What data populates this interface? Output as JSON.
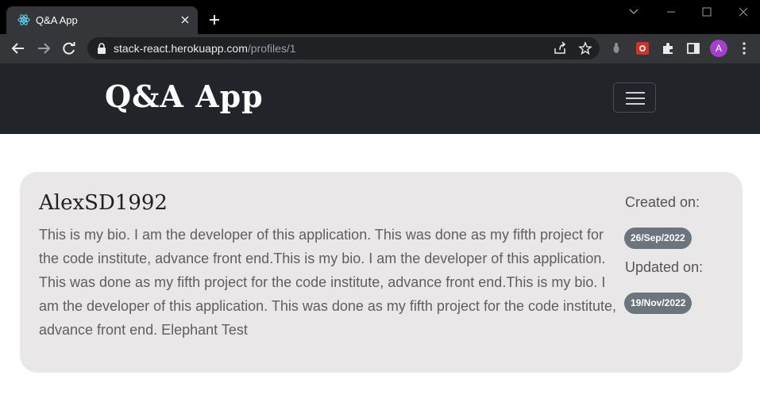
{
  "browser": {
    "tab_title": "Q&A App",
    "url_host": "stack-react.herokuapp.com",
    "url_path": "/profiles/1",
    "profile_initial": "A"
  },
  "navbar": {
    "brand": "Q&A App"
  },
  "profile": {
    "username": "AlexSD1992",
    "bio": "This is my bio. I am the developer of this application. This was done as my fifth project for the code institute, advance front end.This is my bio. I am the developer of this application. This was done as my fifth project for the code institute, advance front end.This is my bio. I am the developer of this application. This was done as my fifth project for the code institute, advance front end. Elephant Test",
    "created_label": "Created on:",
    "created_date": "26/Sep/2022",
    "updated_label": "Updated on:",
    "updated_date": "19/Nov/2022"
  },
  "colors": {
    "navbar": "#212529",
    "card": "#e9e7e8",
    "badge": "#6c757d"
  }
}
